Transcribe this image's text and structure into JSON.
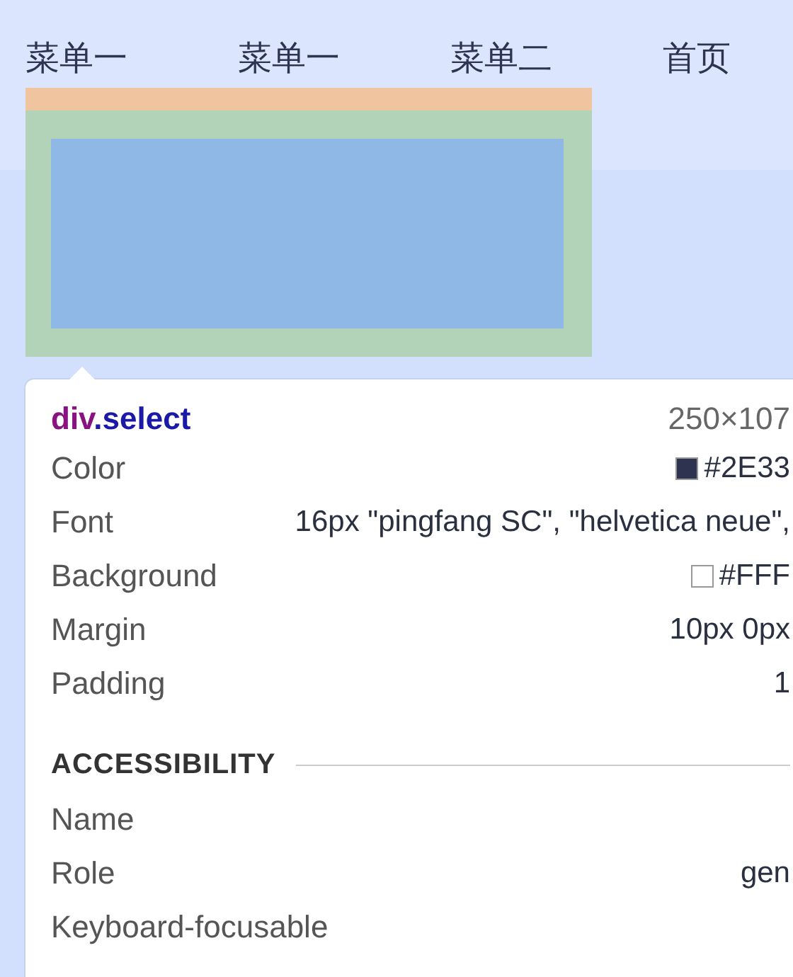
{
  "menu": [
    {
      "label": "菜单一"
    },
    {
      "label": "菜单一"
    },
    {
      "label": "菜单二"
    },
    {
      "label": "首页"
    }
  ],
  "inspect_tooltip": {
    "tag": "div",
    "class_name": ".select",
    "size": "250×107",
    "properties": [
      {
        "label": "Color",
        "value": "#2E33",
        "color": "#2e3350"
      },
      {
        "label": "Font",
        "value": "16px \"pingfang SC\", \"helvetica neue\","
      },
      {
        "label": "Background",
        "value": "#FFF",
        "color": "#ffffff"
      },
      {
        "label": "Margin",
        "value": "10px 0px"
      },
      {
        "label": "Padding",
        "value": "1"
      }
    ],
    "section_title": "ACCESSIBILITY",
    "accessibility": [
      {
        "label": "Name"
      },
      {
        "label": "Role",
        "value": "gen"
      },
      {
        "label": "Keyboard-focusable"
      }
    ]
  }
}
